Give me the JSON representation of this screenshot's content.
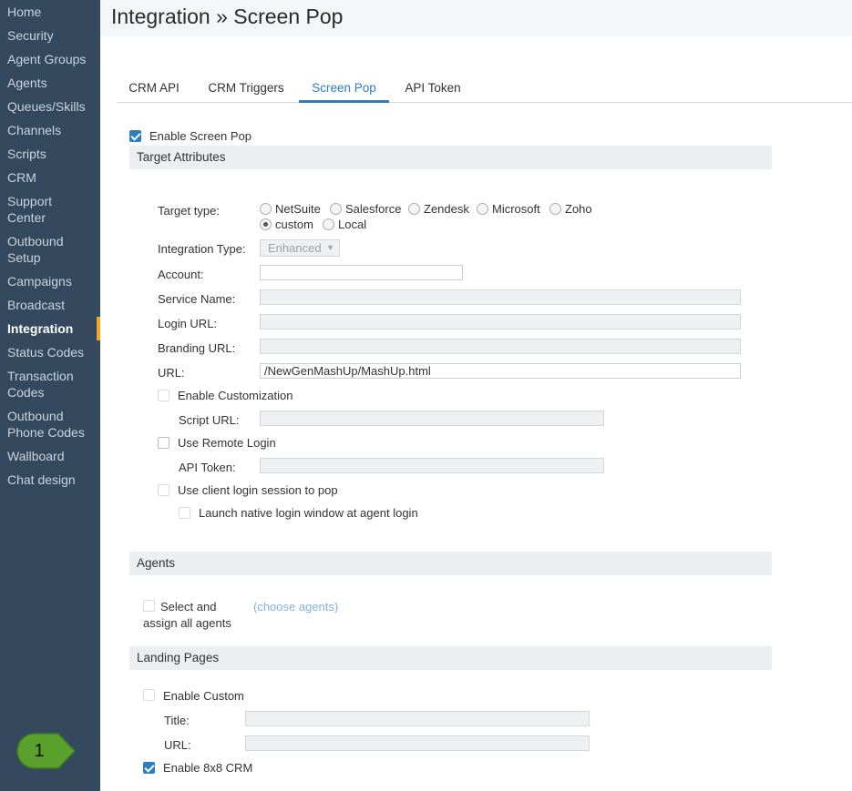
{
  "sidebar": {
    "items": [
      {
        "label": "Home"
      },
      {
        "label": "Security"
      },
      {
        "label": "Agent Groups"
      },
      {
        "label": "Agents"
      },
      {
        "label": "Queues/Skills"
      },
      {
        "label": "Channels"
      },
      {
        "label": "Scripts"
      },
      {
        "label": "CRM"
      },
      {
        "label": "Support",
        "label2": "Center"
      },
      {
        "label": "Outbound",
        "label2": "Setup"
      },
      {
        "label": "Campaigns"
      },
      {
        "label": "Broadcast"
      },
      {
        "label": "Integration"
      },
      {
        "label": "Status Codes"
      },
      {
        "label": "Transaction",
        "label2": "Codes"
      },
      {
        "label": "Outbound",
        "label2": "Phone Codes"
      },
      {
        "label": "Wallboard"
      },
      {
        "label": "Chat design"
      }
    ],
    "active": "Integration",
    "step_badge": "1"
  },
  "header": {
    "title": "Integration » Screen Pop"
  },
  "tabs": {
    "items": [
      {
        "label": "CRM API"
      },
      {
        "label": "CRM Triggers"
      },
      {
        "label": "Screen Pop"
      },
      {
        "label": "API Token"
      }
    ],
    "active": "Screen Pop"
  },
  "screen_pop": {
    "enable_label": "Enable Screen Pop",
    "enable_checked": true,
    "target_section": "Target Attributes",
    "target_type_label": "Target type:",
    "target_types": [
      {
        "label": "NetSuite",
        "checked": false
      },
      {
        "label": "Salesforce",
        "checked": false
      },
      {
        "label": "Zendesk",
        "checked": false
      },
      {
        "label": "Microsoft",
        "checked": false
      },
      {
        "label": "Zoho",
        "checked": false
      },
      {
        "label": "custom",
        "checked": true
      },
      {
        "label": "Local",
        "checked": false
      }
    ],
    "integration_type_label": "Integration Type:",
    "integration_type_value": "Enhanced",
    "account_label": "Account:",
    "account_value": "",
    "service_name_label": "Service Name:",
    "login_url_label": "Login URL:",
    "branding_url_label": "Branding URL:",
    "url_label": "URL:",
    "url_value": "/NewGenMashUp/MashUp.html",
    "enable_customization_label": "Enable Customization",
    "script_url_label": "Script URL:",
    "use_remote_login_label": "Use Remote Login",
    "api_token_label": "API Token:",
    "use_client_login_label": "Use client login session to pop",
    "launch_native_label": "Launch native login window at agent login"
  },
  "agents": {
    "section": "Agents",
    "select_all_label_1": "Select and",
    "select_all_label_2": "assign all agents",
    "choose_agents_link": "(choose agents)"
  },
  "landing_pages": {
    "section": "Landing Pages",
    "enable_custom_label": "Enable Custom",
    "title_label": "Title:",
    "url_label": "URL:",
    "enable_8x8_label": "Enable 8x8 CRM",
    "enable_8x8_checked": true
  },
  "colors": {
    "sidebar_bg": "#34495e",
    "accent": "#2a7fc2",
    "active_marker": "#f5a623",
    "badge_green": "#5aa02c"
  }
}
